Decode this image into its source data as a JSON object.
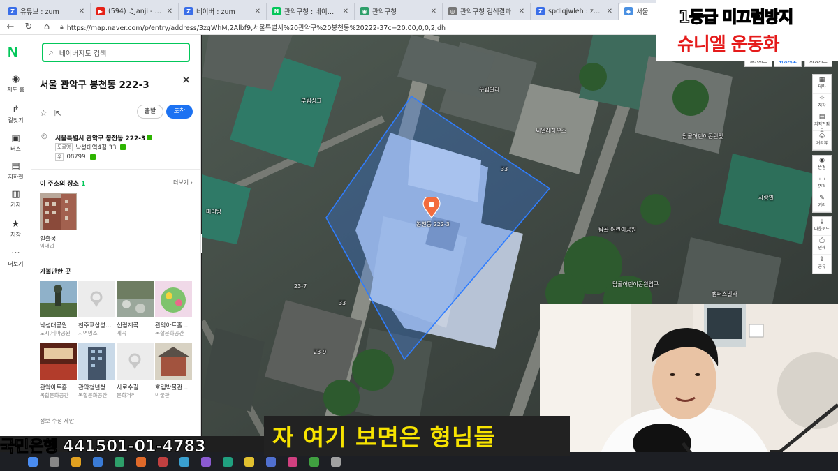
{
  "browser": {
    "tabs": [
      {
        "icon": "zum-icon",
        "color": "#3a6ee8",
        "glyph": "Z",
        "title": "유튜브 : zum"
      },
      {
        "icon": "youtube-icon",
        "color": "#e62117",
        "glyph": "▶",
        "title": "(594) ♫Janji - Heroes Tonight"
      },
      {
        "icon": "zum-icon",
        "color": "#3a6ee8",
        "glyph": "Z",
        "title": "네이버 : zum"
      },
      {
        "icon": "naver-icon",
        "color": "#03c75a",
        "glyph": "N",
        "title": "관악구청 : 네이버 검색"
      },
      {
        "icon": "globe-icon",
        "color": "#2e9f6a",
        "glyph": "◉",
        "title": "관악구청"
      },
      {
        "icon": "globe-icon",
        "color": "#777777",
        "glyph": "◎",
        "title": "관악구청 검색결과"
      },
      {
        "icon": "zum-icon",
        "color": "#3a6ee8",
        "glyph": "Z",
        "title": "spdlqjwleh : zum"
      },
      {
        "icon": "map-icon",
        "color": "#4a90e2",
        "glyph": "◆",
        "title": "서울"
      }
    ],
    "url": "https://map.naver.com/p/entry/address/3zgWhM,2Albf9,서울특별시%20관악구%20봉천동%20222-37c=20.00,0,0,2,dh"
  },
  "rail": {
    "items": [
      {
        "icon": "pin-icon",
        "glyph": "◉",
        "label": "지도 홈"
      },
      {
        "icon": "directions-icon",
        "glyph": "↱",
        "label": "길찾기"
      },
      {
        "icon": "bus-icon",
        "glyph": "▣",
        "label": "버스"
      },
      {
        "icon": "subway-icon",
        "glyph": "▤",
        "label": "지하철"
      },
      {
        "icon": "train-icon",
        "glyph": "▥",
        "label": "기차"
      },
      {
        "icon": "star-icon",
        "glyph": "★",
        "label": "저장"
      },
      {
        "icon": "more-icon",
        "glyph": "···",
        "label": "더보기"
      }
    ]
  },
  "panel": {
    "search_placeholder": "네이버지도 검색",
    "title": "서울 관악구 봉천동 222-3",
    "close": "✕",
    "depart": "출발",
    "arrive": "도착",
    "address_main": "서울특별시 관악구 봉천동 222-3",
    "road_chip": "도로명",
    "road_address": "낙성대역4길 33",
    "zip_chip": "우",
    "zip": "08799",
    "places_title": "이 주소의 장소",
    "places_count": "1",
    "more": "더보기 ›",
    "place": {
      "name": "일출봉",
      "category": "임대업"
    },
    "nearby_title": "가볼만한 곳",
    "nearby": [
      {
        "name": "낙성대공원",
        "category": "도시,테마공원"
      },
      {
        "name": "천주교삼성산...",
        "category": "지역명소"
      },
      {
        "name": "신림계곡",
        "category": "계곡"
      },
      {
        "name": "관악아트홀 ...",
        "category": "복합문화공간"
      },
      {
        "name": "관악아트홀",
        "category": "복합문화공간"
      },
      {
        "name": "관악청년청",
        "category": "복합문화공간"
      },
      {
        "name": "사로수길",
        "category": "문화거리"
      },
      {
        "name": "호림박물관 ...",
        "category": "박물관"
      }
    ],
    "footer": "정보 수정 제안"
  },
  "map": {
    "pin_label": "봉천동 222-3",
    "labels": {
      "l1": "부림싱크",
      "l2": "우림빌라",
      "l3": "씨엘레하우스",
      "l4": "탑골어린이공원앞",
      "l5": "사랑빌",
      "l6": "탑골 어린이공원",
      "l7": "탑골어린이공원입구",
      "l8": "캠퍼스빌라",
      "l9": "머리방",
      "l10": "23-7",
      "l11": "33",
      "l12": "23-9",
      "l13": "33"
    },
    "toggles": [
      "일반지도",
      "위성지도",
      "지형지도"
    ],
    "tools": [
      {
        "icon": "layers-icon",
        "glyph": "▦",
        "label": "테마"
      },
      {
        "icon": "bookmark-icon",
        "glyph": "☆",
        "label": "저장"
      },
      {
        "icon": "cadastral-icon",
        "glyph": "▤",
        "label": "지적편집도"
      },
      {
        "icon": "street-icon",
        "glyph": "◎",
        "label": "거리뷰"
      },
      {
        "icon": "location-icon",
        "glyph": "◉",
        "label": "반경"
      },
      {
        "icon": "area-icon",
        "glyph": "⬚",
        "label": "면적"
      },
      {
        "icon": "pencil-icon",
        "glyph": "✎",
        "label": "거리"
      },
      {
        "icon": "download-icon",
        "glyph": "⤓",
        "label": "다운로드"
      },
      {
        "icon": "print-icon",
        "glyph": "⎙",
        "label": "인쇄"
      },
      {
        "icon": "share-icon",
        "glyph": "⇪",
        "label": "공유"
      }
    ]
  },
  "overlay": {
    "promo_line1": "1등급 미끄럼방지",
    "promo_line2": "슈니엘 운동화",
    "bank_account": "국민은행 441501-01-4783",
    "subtitle": "자 여기 보면은 형님들"
  },
  "colors": {
    "naver_green": "#03c75a",
    "arrive_blue": "#1c72f2",
    "subtitle_yellow": "#f7e300",
    "promo_red": "#e51b1b",
    "parcel_outline": "#2f7dff"
  }
}
